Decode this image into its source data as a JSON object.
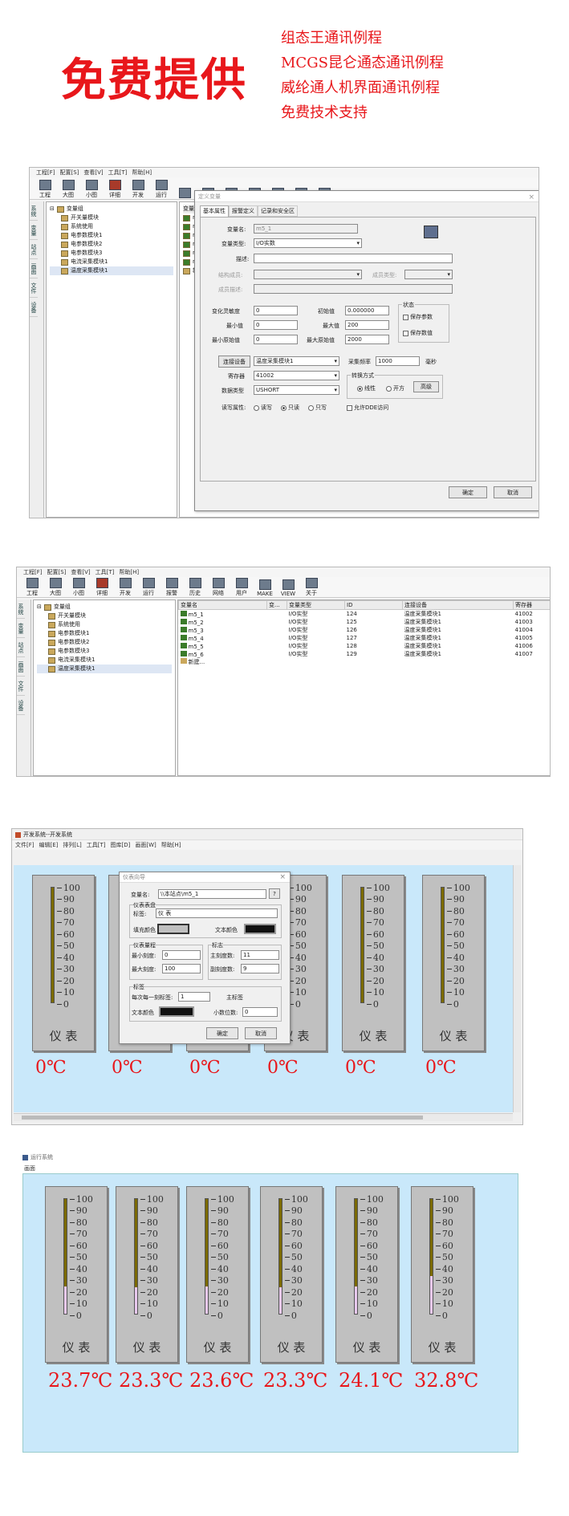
{
  "hero": {
    "title": "免费提供",
    "features": [
      "组态王通讯例程",
      "MCGS昆仑通态通讯例程",
      "威纶通人机界面通讯例程",
      "免费技术支持"
    ]
  },
  "kingview": {
    "menu": [
      "工程[F]",
      "配置[S]",
      "查看[V]",
      "工具[T]",
      "帮助[H]"
    ],
    "toolbar1": [
      "工程",
      "大图",
      "小图",
      "详细",
      "开发",
      "运行"
    ],
    "toolbar2": [
      "工程",
      "大图",
      "小图",
      "详细",
      "开发",
      "运行",
      "报警",
      "历史",
      "网络",
      "用户",
      "MAKE",
      "VIEW",
      "关于"
    ],
    "side_tabs": [
      "系统",
      "变量",
      "站点",
      "画面",
      "文件",
      "设备"
    ],
    "tree_root": "变量组",
    "tree_items": [
      "开关量模块",
      "系统使用",
      "电参数模块1",
      "电参数模块2",
      "电参数模块3",
      "电流采集模块1",
      "温度采集模块1"
    ],
    "list_col": "变量名",
    "list_items": [
      "m5",
      "m5",
      "m5",
      "m5",
      "m5",
      "m5",
      "新建"
    ]
  },
  "var_dialog": {
    "title": "定义变量",
    "tabs": [
      "基本属性",
      "报警定义",
      "记录和安全区"
    ],
    "labels": {
      "name": "变量名:",
      "type": "变量类型:",
      "desc": "描述:",
      "struct": "结构成员:",
      "member_type": "成员类型:",
      "member_desc": "成员描述:",
      "change_sens": "变化灵敏度",
      "min": "最小值",
      "min_raw": "最小原始值",
      "init": "初始值",
      "max": "最大值",
      "max_raw": "最大原始值",
      "state": "状态",
      "save_param": "保存参数",
      "save_value": "保存数值",
      "device_btn": "连接设备",
      "reg": "寄存器",
      "data_type": "数据类型",
      "rw": "读写属性:",
      "scan": "采集频率",
      "ms": "毫秒",
      "convert": "转换方式",
      "linear": "线性",
      "sqrt": "开方",
      "advanced": "高级",
      "dde": "允许DDE访问",
      "read_write": "读写",
      "read_only": "只读",
      "write_only": "只写",
      "ok": "确定",
      "cancel": "取消"
    },
    "values": {
      "name": "m5_1",
      "type": "I/O实数",
      "change_sens": "0",
      "min": "0",
      "min_raw": "0",
      "init": "0.000000",
      "max": "200",
      "max_raw": "2000",
      "device": "温度采集模块1",
      "reg": "41002",
      "data_type": "USHORT",
      "scan": "1000"
    }
  },
  "var_table": {
    "columns": [
      "变量名",
      "变...",
      "变量类型",
      "ID",
      "连接设备",
      "寄存器"
    ],
    "rows": [
      [
        "m5_1",
        "",
        "I/O实型",
        "124",
        "温度采集模块1",
        "41002"
      ],
      [
        "m5_2",
        "",
        "I/O实型",
        "125",
        "温度采集模块1",
        "41003"
      ],
      [
        "m5_3",
        "",
        "I/O实型",
        "126",
        "温度采集模块1",
        "41004"
      ],
      [
        "m5_4",
        "",
        "I/O实型",
        "127",
        "温度采集模块1",
        "41005"
      ],
      [
        "m5_5",
        "",
        "I/O实型",
        "128",
        "温度采集模块1",
        "41006"
      ],
      [
        "m5_6",
        "",
        "I/O实型",
        "129",
        "温度采集模块1",
        "41007"
      ],
      [
        "新建...",
        "",
        "",
        "",
        "",
        ""
      ]
    ]
  },
  "editor": {
    "title": "开发系统--开发系统",
    "menu": [
      "文件[F]",
      "编辑[E]",
      "排列[L]",
      "工具[T]",
      "图库[D]",
      "画面[W]",
      "帮助[H]"
    ]
  },
  "meter_dialog": {
    "title": "仪表向导",
    "var_label": "变量名:",
    "var_value": "\\\\本站点\\m5_1",
    "group_meter": "仪表表盘",
    "title_label": "标签:",
    "title_value": "仪 表",
    "bg_color_label": "填充颜色",
    "text_color_label": "文本颜色",
    "range_group": "仪表量程",
    "min_label": "最小刻度:",
    "min_value": "0",
    "max_label": "最大刻度:",
    "max_value": "100",
    "tick_group": "标志",
    "major_label": "主刻度数:",
    "major_value": "11",
    "minor_label": "副刻度数:",
    "minor_value": "9",
    "tag_group": "标签",
    "tag_every_label": "每次每一刻标签:",
    "tag_every_value": "1",
    "main_label": "主标签",
    "text_color2": "文本颜色",
    "decimal_label": "小数位数:",
    "decimal_value": "0",
    "ok": "确定",
    "cancel": "取消"
  },
  "gauges": {
    "scale": [
      "100",
      "90",
      "80",
      "70",
      "60",
      "50",
      "40",
      "30",
      "20",
      "10",
      "0"
    ],
    "label": "仪 表",
    "unit": "℃"
  },
  "run": {
    "title": "运行系统",
    "menu": "画面",
    "values": [
      "23.7",
      "23.3",
      "23.6",
      "23.3",
      "24.1",
      "32.8"
    ],
    "levels": [
      0.237,
      0.233,
      0.236,
      0.233,
      0.241,
      0.328
    ]
  },
  "edit_values": [
    "0",
    "0",
    "0",
    "0",
    "0",
    "0"
  ],
  "colors": {
    "red": "#e8171b",
    "canvas": "#c9e8fa",
    "gauge": "#c0c0c0",
    "tube_fill_edit": "#7b6a00",
    "tube_fill_run": "#e8c9ee"
  }
}
